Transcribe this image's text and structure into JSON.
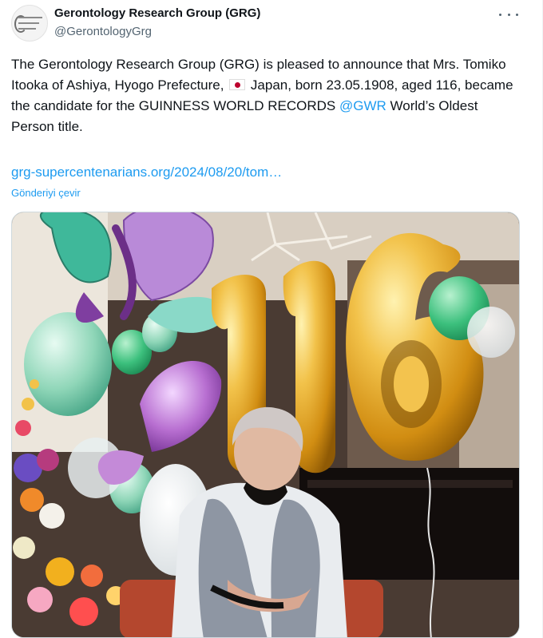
{
  "author": {
    "name": "Gerontology Research Group (GRG)",
    "handle": "@GerontologyGrg",
    "avatar_icon": "grg-logo-icon"
  },
  "tweet": {
    "text_before_flag": "The Gerontology Research Group (GRG) is pleased to announce that Mrs. Tomiko Itooka of Ashiya, Hyogo Prefecture, ",
    "flag_icon": "japan-flag-icon",
    "text_after_flag": " Japan, born 23.05.1908, aged 116, became the candidate for the GUINNESS WORLD RECORDS ",
    "mention": "@GWR",
    "text_end": " World’s Oldest Person title.",
    "link": "grg-supercentenarians.org/2024/08/20/tom…",
    "translate_label": "Gönderiyi çevir"
  },
  "media": {
    "balloon_number": "116"
  },
  "colors": {
    "accent": "#1d9bf0",
    "text": "#0f1419",
    "secondary": "#536471",
    "gold": "#e6a91c"
  }
}
